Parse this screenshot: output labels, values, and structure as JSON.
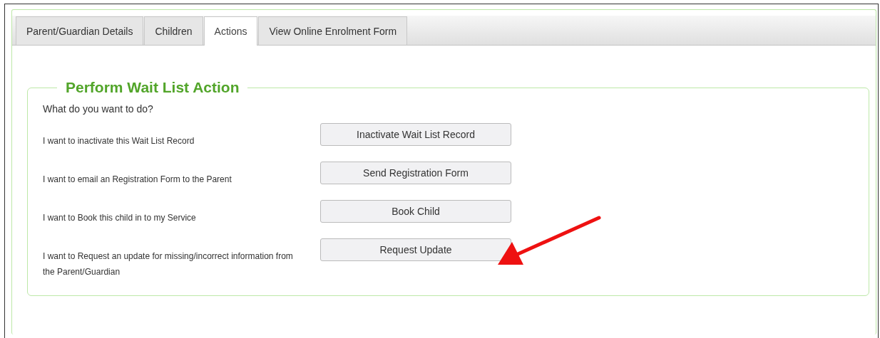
{
  "tabs": [
    {
      "label": "Parent/Guardian Details",
      "selected": false
    },
    {
      "label": "Children",
      "selected": false
    },
    {
      "label": "Actions",
      "selected": true
    },
    {
      "label": "View Online Enrolment Form",
      "selected": false
    }
  ],
  "section": {
    "legend": "Perform Wait List Action",
    "question": "What do you want to do?",
    "actions": [
      {
        "description": "I want to inactivate this Wait List Record",
        "button": "Inactivate Wait List Record"
      },
      {
        "description": "I want to email an Registration Form to the Parent",
        "button": "Send Registration Form"
      },
      {
        "description": "I want to Book this child in to my Service",
        "button": "Book Child"
      },
      {
        "description": "I want to Request an update for missing/incorrect information from the Parent/Guardian",
        "button": "Request Update"
      }
    ]
  }
}
